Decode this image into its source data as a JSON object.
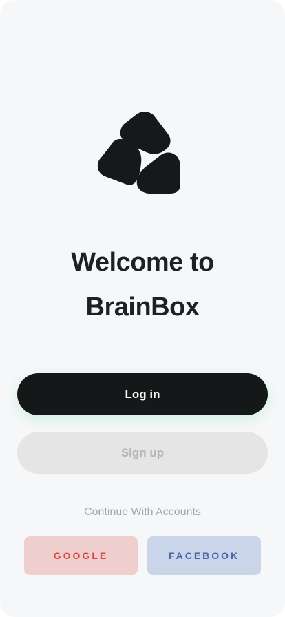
{
  "brand": {
    "logo_icon": "three-rounded-triangles-logo-icon",
    "title_line1": "Welcome to",
    "title_line2": "BrainBox"
  },
  "actions": {
    "login_label": "Log in",
    "signup_label": "Sign up"
  },
  "social": {
    "prompt": "Continue With Accounts",
    "google_label": "GOOGLE",
    "facebook_label": "FACEBOOK"
  },
  "colors": {
    "background": "#f6f7f9",
    "primary_dark": "#141819",
    "google_red": "#d8473d",
    "facebook_blue": "#4467ac"
  }
}
